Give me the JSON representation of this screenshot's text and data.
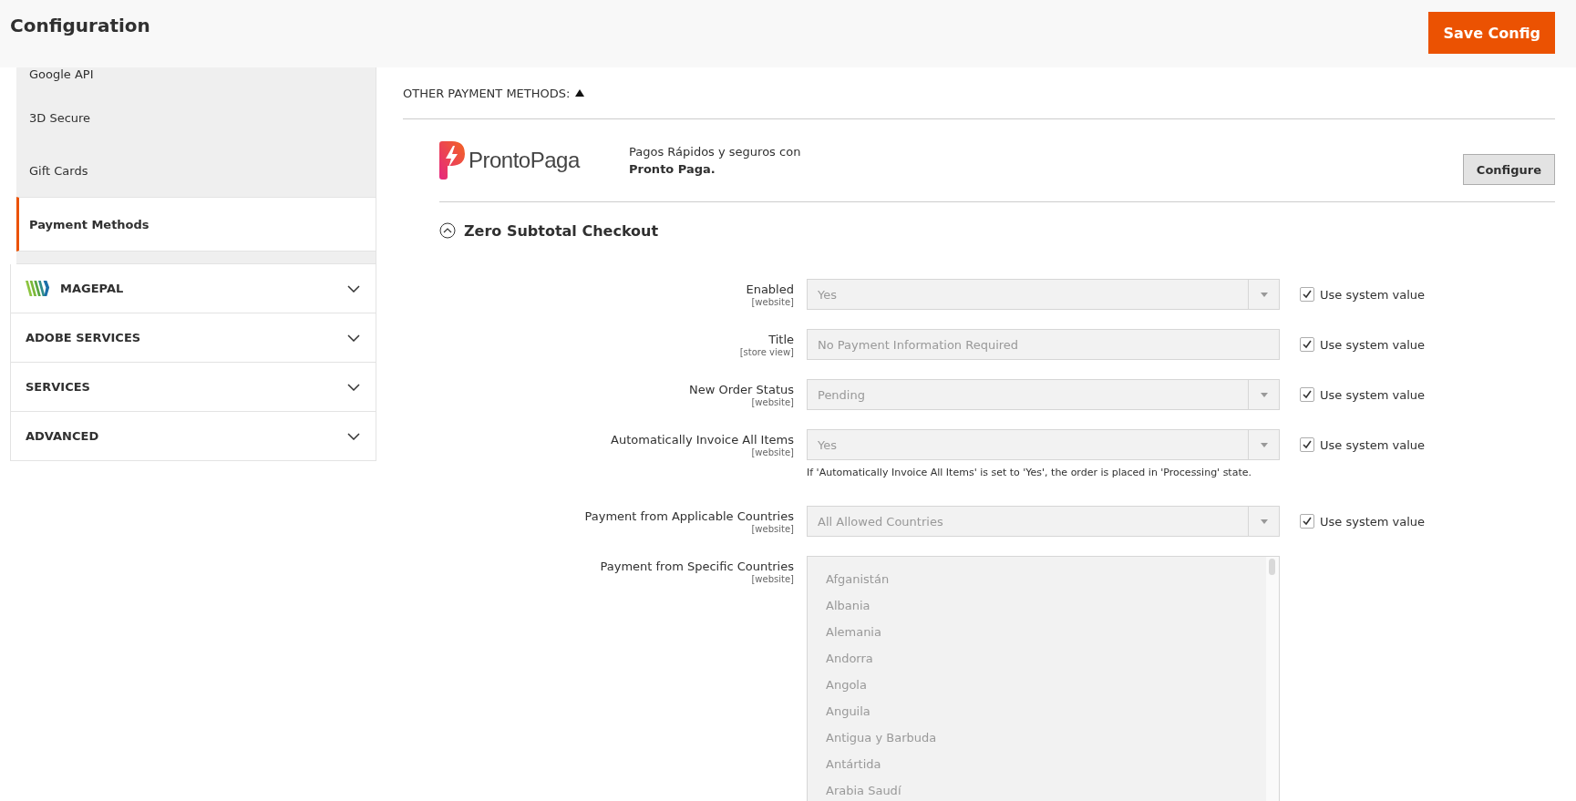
{
  "header": {
    "title": "Configuration",
    "save_button": "Save Config"
  },
  "sidebar": {
    "items": [
      {
        "label": "Google API",
        "selected": false
      },
      {
        "label": "3D Secure",
        "selected": false
      },
      {
        "label": "Gift Cards",
        "selected": false
      },
      {
        "label": "Payment Methods",
        "selected": true
      }
    ],
    "sections": [
      {
        "label": "MAGEPAL",
        "kind": "logo",
        "expanded": false
      },
      {
        "label": "ADOBE SERVICES",
        "kind": "plain",
        "expanded": false
      },
      {
        "label": "SERVICES",
        "kind": "plain",
        "expanded": false
      },
      {
        "label": "ADVANCED",
        "kind": "plain",
        "expanded": false
      }
    ]
  },
  "other_payment_methods": {
    "title": "OTHER PAYMENT METHODS:",
    "expanded": true
  },
  "prontopaga": {
    "logo_text": "ProntoPaga",
    "description": "Pagos Rápidos y seguros con",
    "brand": "Pronto Paga.",
    "button": "Configure"
  },
  "group": {
    "title": "Zero Subtotal Checkout",
    "expanded": true,
    "fields": [
      {
        "kind": "select",
        "label": "Enabled",
        "scope": "[website]",
        "value": "Yes",
        "use_system_value": "Use system value",
        "checked": true,
        "disabled": true
      },
      {
        "kind": "text",
        "label": "Title",
        "scope": "[store view]",
        "value": "No Payment Information Required",
        "use_system_value": "Use system value",
        "checked": true,
        "disabled": true
      },
      {
        "kind": "select",
        "label": "New Order Status",
        "scope": "[website]",
        "value": "Pending",
        "use_system_value": "Use system value",
        "checked": true,
        "disabled": true
      },
      {
        "kind": "select",
        "label": "Automatically Invoice All Items",
        "scope": "[website]",
        "value": "Yes",
        "use_system_value": "Use system value",
        "checked": true,
        "disabled": true,
        "note": "If 'Automatically Invoice All Items' is set to 'Yes', the order is placed in 'Processing' state."
      },
      {
        "kind": "select",
        "label": "Payment from Applicable Countries",
        "scope": "[website]",
        "value": "All Allowed Countries",
        "use_system_value": "Use system value",
        "checked": true,
        "disabled": true
      },
      {
        "kind": "multiselect",
        "label": "Payment from Specific Countries",
        "scope": "[website]",
        "disabled": true,
        "options": [
          "Afganistán",
          "Albania",
          "Alemania",
          "Andorra",
          "Angola",
          "Anguila",
          "Antigua y Barbuda",
          "Antártida",
          "Arabia Saudí"
        ]
      }
    ]
  }
}
